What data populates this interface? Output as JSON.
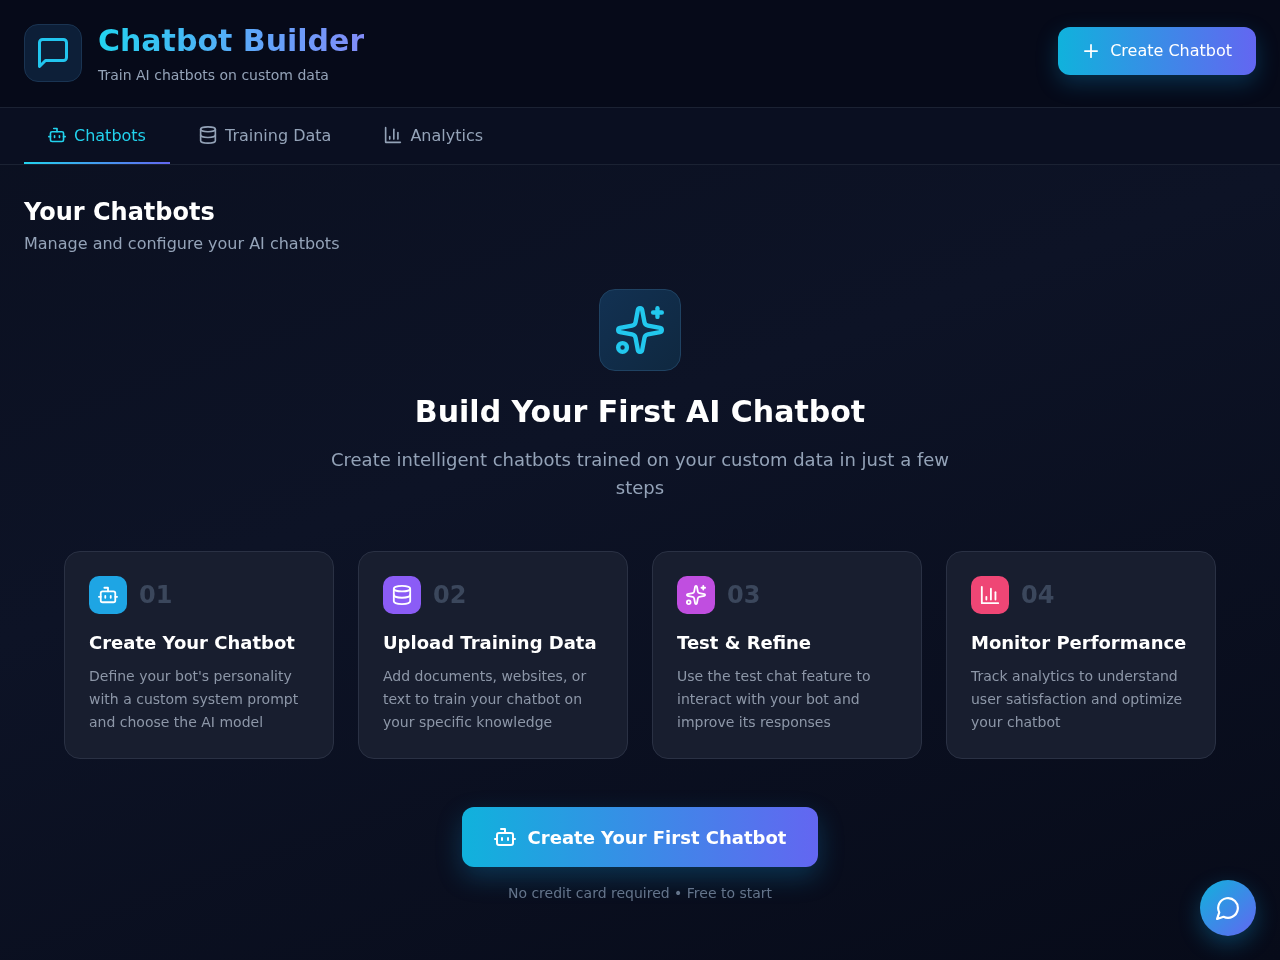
{
  "header": {
    "title": "Chatbot Builder",
    "subtitle": "Train AI chatbots on custom data",
    "button": {
      "label": "Create Chatbot"
    }
  },
  "tabs": [
    {
      "label": "Chatbots",
      "selected": true
    },
    {
      "label": "Training Data",
      "selected": false
    },
    {
      "label": "Analytics",
      "selected": false
    }
  ],
  "section": {
    "title": "Your Chatbots",
    "subtitle": "Manage and configure your AI chatbots"
  },
  "hero": {
    "title": "Build Your First AI Chatbot",
    "description": "Create intelligent chatbots trained on your custom data in just a few steps"
  },
  "steps": [
    {
      "number": "01",
      "title": "Create Your Chatbot",
      "description": "Define your bot's personality with a custom system prompt and choose the AI model",
      "color": "#1ea5e4"
    },
    {
      "number": "02",
      "title": "Upload Training Data",
      "description": "Add documents, websites, or text to train your chatbot on your specific knowledge",
      "color": "#8b5cf6"
    },
    {
      "number": "03",
      "title": "Test & Refine",
      "description": "Use the test chat feature to interact with your bot and improve its responses",
      "color": "#c04ee0"
    },
    {
      "number": "04",
      "title": "Monitor Performance",
      "description": "Track analytics to understand user satisfaction and optimize your chatbot",
      "color": "#ef4675"
    }
  ],
  "cta": {
    "label": "Create Your First Chatbot",
    "note": "No credit card required • Free to start"
  }
}
